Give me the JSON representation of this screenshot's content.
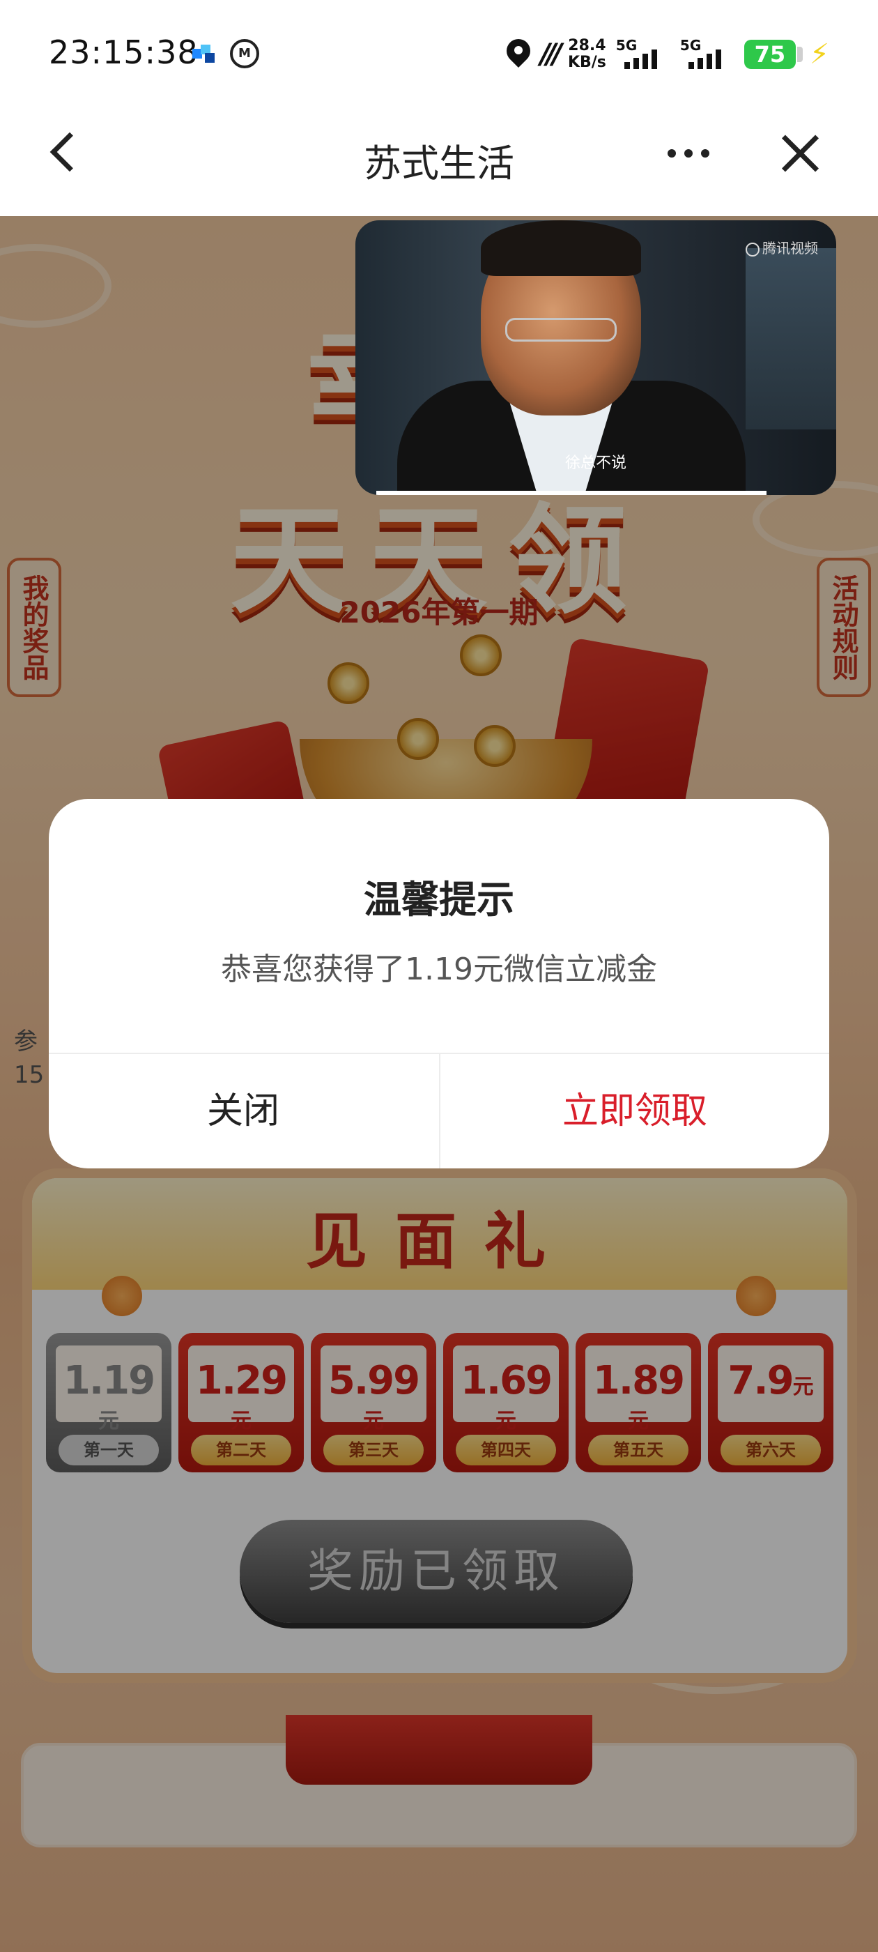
{
  "status_bar": {
    "time": "23:15:38",
    "speed_value": "28.4",
    "speed_unit": "KB/s",
    "network1": "5G",
    "network2": "5G",
    "battery": "75"
  },
  "nav": {
    "title": "苏式生活"
  },
  "page": {
    "headline_line1": "幸运",
    "headline_line2": "天天领",
    "period": "2026年第一期",
    "my_prizes": "我的奖品",
    "rules": "活动规则",
    "participants_line1": "参",
    "participants_line2": "15",
    "gift_title": "见面礼",
    "cards": [
      {
        "amount": "1.19",
        "unit": "元",
        "day": "第一天",
        "claimed": true
      },
      {
        "amount": "1.29",
        "unit": "元",
        "day": "第二天",
        "claimed": false
      },
      {
        "amount": "5.99",
        "unit": "元",
        "day": "第三天",
        "claimed": false
      },
      {
        "amount": "1.69",
        "unit": "元",
        "day": "第四天",
        "claimed": false
      },
      {
        "amount": "1.89",
        "unit": "元",
        "day": "第五天",
        "claimed": false
      },
      {
        "amount": "7.9",
        "unit": "元",
        "day": "第六天",
        "claimed": false
      }
    ],
    "claimed_button": "奖励已领取"
  },
  "video": {
    "source_logo": "腾讯视频",
    "subtitle": "徐总不说"
  },
  "dialog": {
    "title": "温馨提示",
    "message": "恭喜您获得了1.19元微信立减金",
    "close_label": "关闭",
    "confirm_label": "立即领取"
  },
  "colors": {
    "accent_red": "#d91e2a",
    "battery_green": "#2ec84a"
  }
}
